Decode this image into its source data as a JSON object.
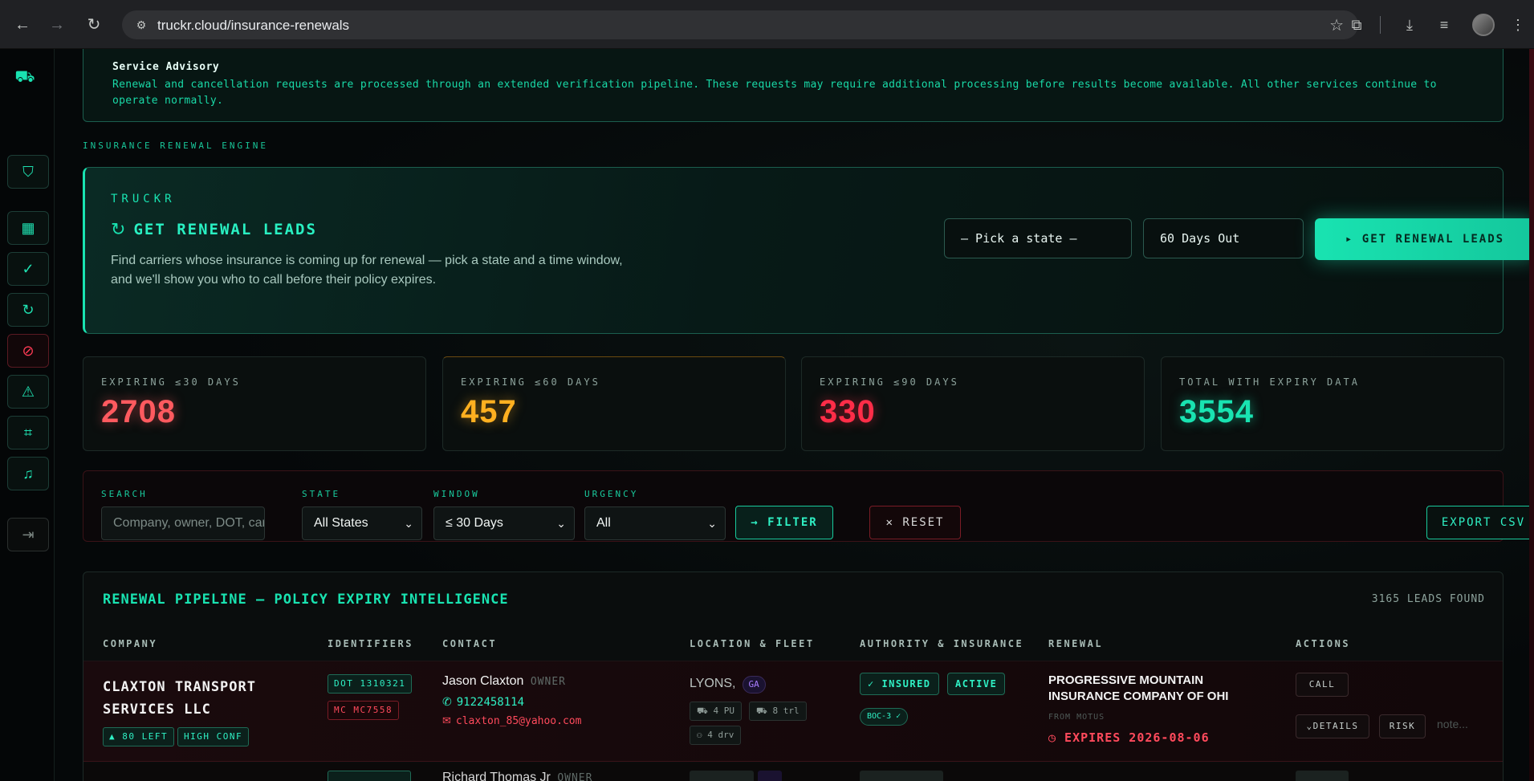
{
  "browser": {
    "url": "truckr.cloud/insurance-renewals"
  },
  "advisory": {
    "title": "Service Advisory",
    "body": "Renewal and cancellation requests are processed through an extended verification pipeline. These requests may require additional processing before results become available. All other services continue to operate normally."
  },
  "section_label": "INSURANCE RENEWAL ENGINE",
  "hero": {
    "brand": "TRUCKR",
    "title": "GET RENEWAL LEADS",
    "description": "Find carriers whose insurance is coming up for renewal — pick a state and a time window, and we'll show you who to call before their policy expires.",
    "state_select": "– Pick a state –",
    "days_select": "60 Days Out",
    "cta": "▸  GET RENEWAL LEADS"
  },
  "stats": [
    {
      "label": "EXPIRING ≤30 DAYS",
      "value": "2708"
    },
    {
      "label": "EXPIRING ≤60 DAYS",
      "value": "457"
    },
    {
      "label": "EXPIRING ≤90 DAYS",
      "value": "330"
    },
    {
      "label": "TOTAL WITH EXPIRY DATA",
      "value": "3554"
    }
  ],
  "filters": {
    "search_label": "SEARCH",
    "search_placeholder": "Company, owner, DOT, carr",
    "state_label": "STATE",
    "state_value": "All States",
    "window_label": "WINDOW",
    "window_value": "≤ 30 Days",
    "urgency_label": "URGENCY",
    "urgency_value": "All",
    "filter_button": "→ FILTER",
    "reset_button": "✕ RESET",
    "export_button": "EXPORT CSV"
  },
  "pipeline": {
    "title": "RENEWAL PIPELINE — POLICY EXPIRY INTELLIGENCE",
    "count": "3165 LEADS FOUND",
    "columns": [
      "COMPANY",
      "IDENTIFIERS",
      "CONTACT",
      "LOCATION & FLEET",
      "AUTHORITY & INSURANCE",
      "RENEWAL",
      "ACTIONS"
    ],
    "rows": [
      {
        "company": "CLAXTON TRANSPORT SERVICES LLC",
        "days_left": "▲ 80 LEFT",
        "confidence": "HIGH CONF",
        "dot": "DOT 1310321",
        "mc": "MC MC7558",
        "contact_name": "Jason Claxton",
        "contact_role": "OWNER",
        "phone": "9122458114",
        "email": "claxton_85@yahoo.com",
        "city": "LYONS,",
        "state": "GA",
        "power_units": "⛟ 4 PU",
        "trailers": "⛟ 8 trl",
        "drivers": "⚇ 4 drv",
        "insured": "✓ INSURED",
        "authority": "ACTIVE",
        "boc": "BOC-3 ✓",
        "insurer": "PROGRESSIVE MOUNTAIN INSURANCE COMPANY OF OHI",
        "from": "FROM MOTUS",
        "expires": "◷ EXPIRES 2026-08-06",
        "call": "CALL",
        "details": "⌄DETAILS",
        "risk": "RISK",
        "note": "note..."
      },
      {
        "contact_name": "Richard Thomas Jr",
        "contact_role": "OWNER"
      }
    ]
  }
}
